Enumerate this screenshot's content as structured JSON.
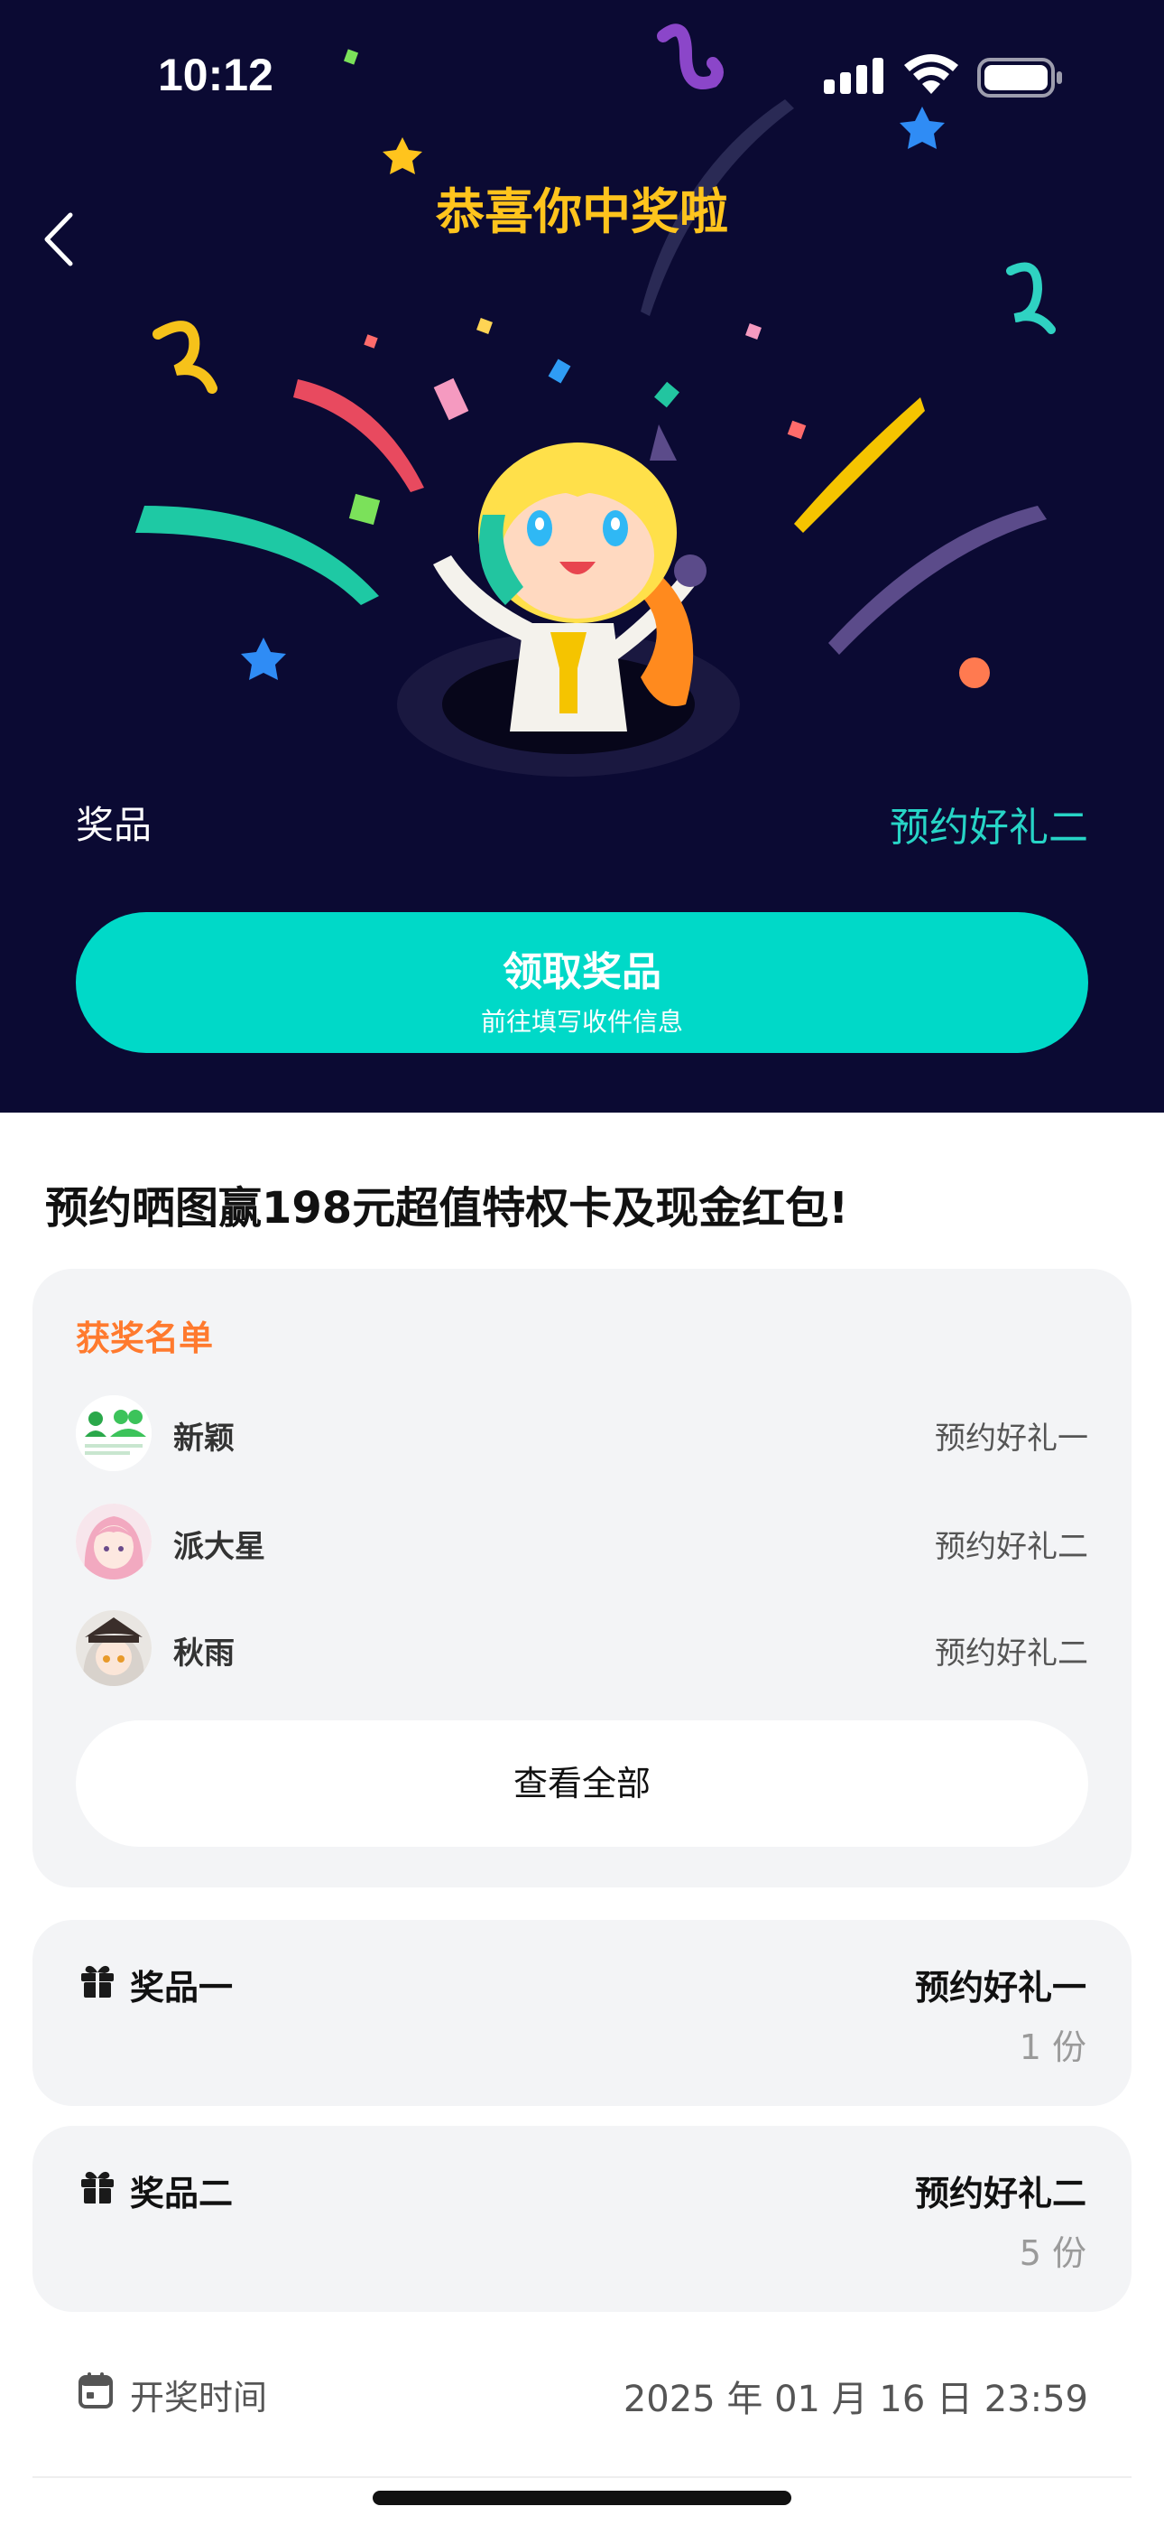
{
  "status_bar": {
    "time": "10:12"
  },
  "hero": {
    "title": "恭喜你中奖啦",
    "prize_label": "奖品",
    "prize_value": "预约好礼二",
    "claim_button": {
      "title": "领取奖品",
      "subtitle": "前往填写收件信息"
    }
  },
  "event": {
    "title": "预约晒图赢198元超值特权卡及现金红包!"
  },
  "winners": {
    "heading": "获奖名单",
    "items": [
      {
        "name": "新颖",
        "prize": "预约好礼一"
      },
      {
        "name": "派大星",
        "prize": "预约好礼二"
      },
      {
        "name": "秋雨",
        "prize": "预约好礼二"
      }
    ],
    "view_all_label": "查看全部"
  },
  "prizes": [
    {
      "name": "奖品一",
      "title": "预约好礼一",
      "quantity": "1 份"
    },
    {
      "name": "奖品二",
      "title": "预约好礼二",
      "quantity": "5 份"
    }
  ],
  "draw": {
    "label": "开奖时间",
    "value": "2025 年 01 月 16 日 23:59"
  },
  "colors": {
    "hero_background": "#0b0a33",
    "title_gold": "#ffc41d",
    "accent_teal": "#00d9c8",
    "winners_heading_orange": "#ff7a2e",
    "card_background": "#f3f4f6"
  },
  "icons": [
    "signal-icon",
    "wifi-icon",
    "battery-icon",
    "back-icon",
    "gift-icon",
    "calendar-icon"
  ]
}
